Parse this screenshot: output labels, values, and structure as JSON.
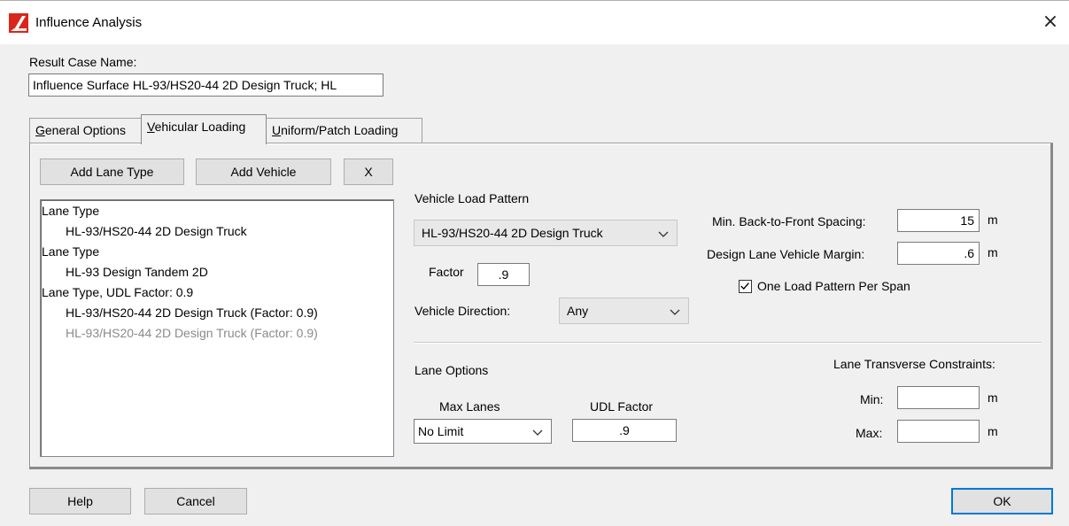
{
  "window": {
    "title": "Influence Analysis",
    "close_glyph": "×",
    "app_icon": "app-logo-icon"
  },
  "result_case": {
    "label": "Result Case Name:",
    "value": "Influence Surface HL-93/HS20-44 2D Design Truck; HL"
  },
  "tabs": [
    {
      "label_first": "G",
      "label_rest": "eneral Options"
    },
    {
      "label_first": "V",
      "label_rest": "ehicular Loading"
    },
    {
      "label_first": "U",
      "label_rest": "niform/Patch Loading"
    }
  ],
  "toolbar": {
    "add_lane_type": "Add Lane Type",
    "add_vehicle": "Add Vehicle",
    "delete": "X"
  },
  "lane_list": [
    {
      "text": "Lane Type",
      "indent": 0,
      "style": "normal"
    },
    {
      "text": "HL-93/HS20-44 2D Design Truck",
      "indent": 1,
      "style": "normal"
    },
    {
      "text": "Lane Type",
      "indent": 0,
      "style": "normal"
    },
    {
      "text": "HL-93 Design Tandem 2D",
      "indent": 1,
      "style": "normal"
    },
    {
      "text": "Lane Type, UDL Factor: 0.9",
      "indent": 0,
      "style": "normal"
    },
    {
      "text": "HL-93/HS20-44 2D Design Truck (Factor: 0.9)",
      "indent": 1,
      "style": "normal"
    },
    {
      "text": "HL-93/HS20-44 2D Design Truck (Factor: 0.9)",
      "indent": 1,
      "style": "gray"
    }
  ],
  "vehicle": {
    "load_pattern_label": "Vehicle Load Pattern",
    "load_pattern_value": "HL-93/HS20-44 2D Design Truck",
    "factor_label": "Factor",
    "factor_value": ".9",
    "direction_label": "Vehicle Direction:",
    "direction_value": "Any"
  },
  "spacing": {
    "min_back_to_front_label": "Min. Back-to-Front Spacing:",
    "min_back_to_front_value": "15",
    "margin_label": "Design Lane Vehicle Margin:",
    "margin_value": ".6",
    "unit": "m",
    "one_load_pattern_label": "One Load Pattern Per Span",
    "one_load_pattern_checked": true
  },
  "lane_options": {
    "title": "Lane Options",
    "max_lanes_label": "Max Lanes",
    "max_lanes_value": "No Limit",
    "udl_factor_label": "UDL Factor",
    "udl_factor_value": ".9"
  },
  "transverse": {
    "title": "Lane Transverse Constraints:",
    "min_label": "Min:",
    "max_label": "Max:",
    "min_value": "",
    "max_value": "",
    "unit": "m"
  },
  "footer": {
    "help": "Help",
    "cancel": "Cancel",
    "ok": "OK"
  },
  "colors": {
    "accent": "#0078d7",
    "logo_red": "#d9261c",
    "disabled_text": "#8a8a8a"
  }
}
